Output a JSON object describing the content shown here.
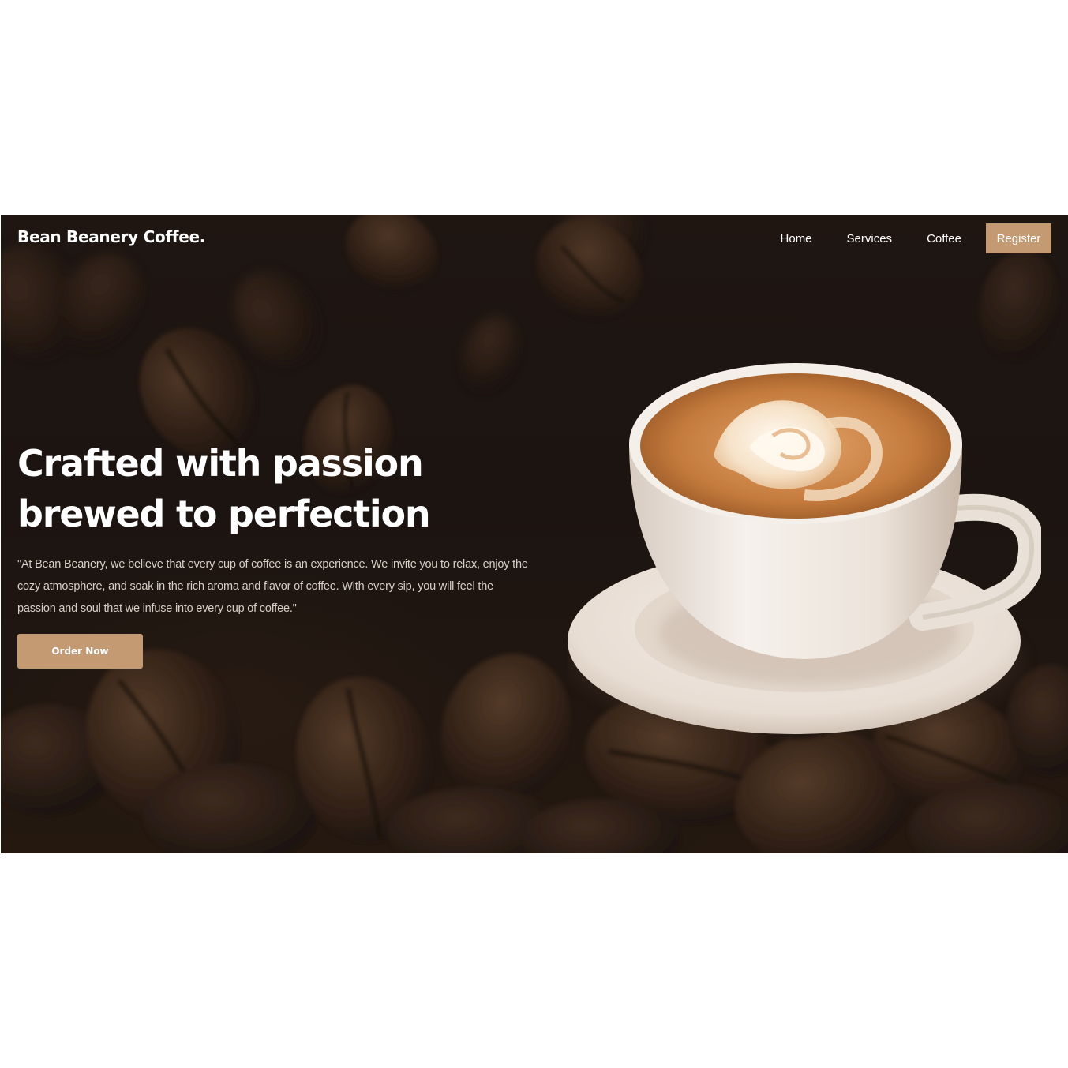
{
  "brand": {
    "name": "Bean Beanery Coffee."
  },
  "nav": {
    "links": [
      "Home",
      "Services",
      "Coffee"
    ],
    "register_label": "Register"
  },
  "hero": {
    "headline_line1": "Crafted with passion",
    "headline_line2": "brewed to perfection",
    "quote": "\"At Bean Beanery, we believe that every cup of coffee is an experience. We invite you to relax, enjoy the cozy atmosphere, and soak in the rich aroma and flavor of coffee. With every sip, you will feel the passion and soul that we infuse into every cup of coffee.\"",
    "cta_label": "Order Now"
  },
  "colors": {
    "accent": "#c39a72",
    "background": "#231a16",
    "text": "#ffffff"
  },
  "icons": {
    "background": "coffee-beans-image",
    "hero_image": "latte-cup-image"
  }
}
